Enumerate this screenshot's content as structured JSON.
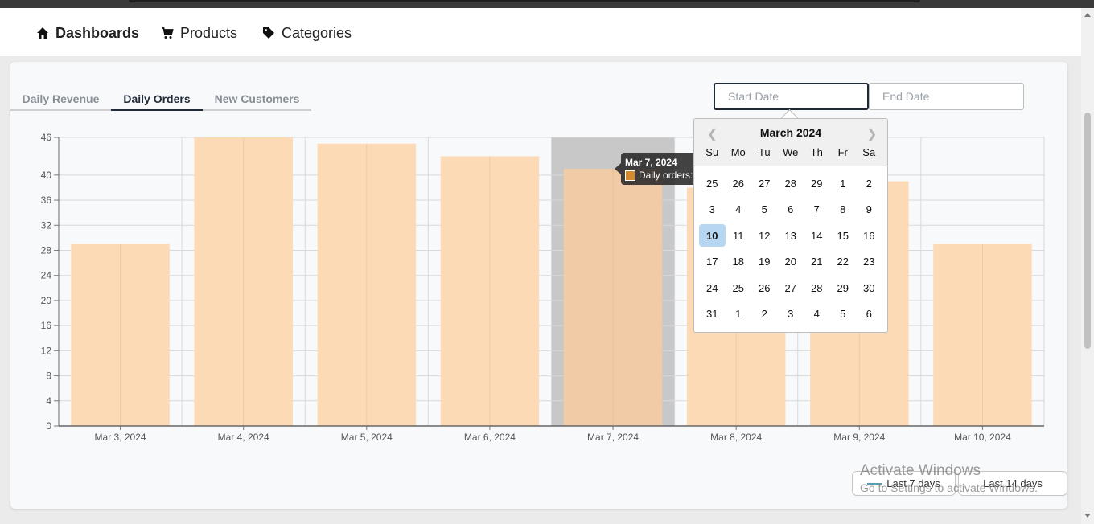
{
  "nav": {
    "items": [
      {
        "label": "Dashboards",
        "icon": "home-icon"
      },
      {
        "label": "Products",
        "icon": "cart-icon"
      },
      {
        "label": "Categories",
        "icon": "tag-icon"
      }
    ]
  },
  "tabs": [
    {
      "label": "Daily Revenue"
    },
    {
      "label": "Daily Orders"
    },
    {
      "label": "New Customers"
    }
  ],
  "date_range": {
    "start_placeholder": "Start Date",
    "end_placeholder": "End Date"
  },
  "calendar": {
    "month_label": "March 2024",
    "prev_icon": "chevron-left-icon",
    "next_icon": "chevron-right-icon",
    "weekdays": [
      "Su",
      "Mo",
      "Tu",
      "We",
      "Th",
      "Fr",
      "Sa"
    ],
    "weeks": [
      [
        "25",
        "26",
        "27",
        "28",
        "29",
        "1",
        "2"
      ],
      [
        "3",
        "4",
        "5",
        "6",
        "7",
        "8",
        "9"
      ],
      [
        "10",
        "11",
        "12",
        "13",
        "14",
        "15",
        "16"
      ],
      [
        "17",
        "18",
        "19",
        "20",
        "21",
        "22",
        "23"
      ],
      [
        "24",
        "25",
        "26",
        "27",
        "28",
        "29",
        "30"
      ],
      [
        "31",
        "1",
        "2",
        "3",
        "4",
        "5",
        "6"
      ]
    ],
    "highlighted_day": "10"
  },
  "tooltip": {
    "title": "Mar 7, 2024",
    "label": "Daily orders:"
  },
  "chart_data": {
    "type": "bar",
    "categories": [
      "Mar 3, 2024",
      "Mar 4, 2024",
      "Mar 5, 2024",
      "Mar 6, 2024",
      "Mar 7, 2024",
      "Mar 8, 2024",
      "Mar 9, 2024",
      "Mar 10, 2024"
    ],
    "series": [
      {
        "values": [
          29,
          46,
          45,
          43,
          41,
          38,
          39,
          29
        ]
      }
    ],
    "yticks": [
      0,
      4,
      8,
      12,
      16,
      20,
      24,
      28,
      32,
      36,
      40,
      46
    ],
    "ylim": [
      0,
      46
    ],
    "grid": true,
    "highlighted_category": "Mar 7, 2024",
    "colors": {
      "bar": "#fcdab6",
      "bar_hover": "#f0cba6",
      "hover_band": "#c8c8c8"
    }
  },
  "buttons": {
    "last7": "Last 7 days",
    "last14": "Last 14 days"
  },
  "watermark": {
    "line1": "Activate Windows",
    "line2": "Go to Settings to activate Windows."
  }
}
